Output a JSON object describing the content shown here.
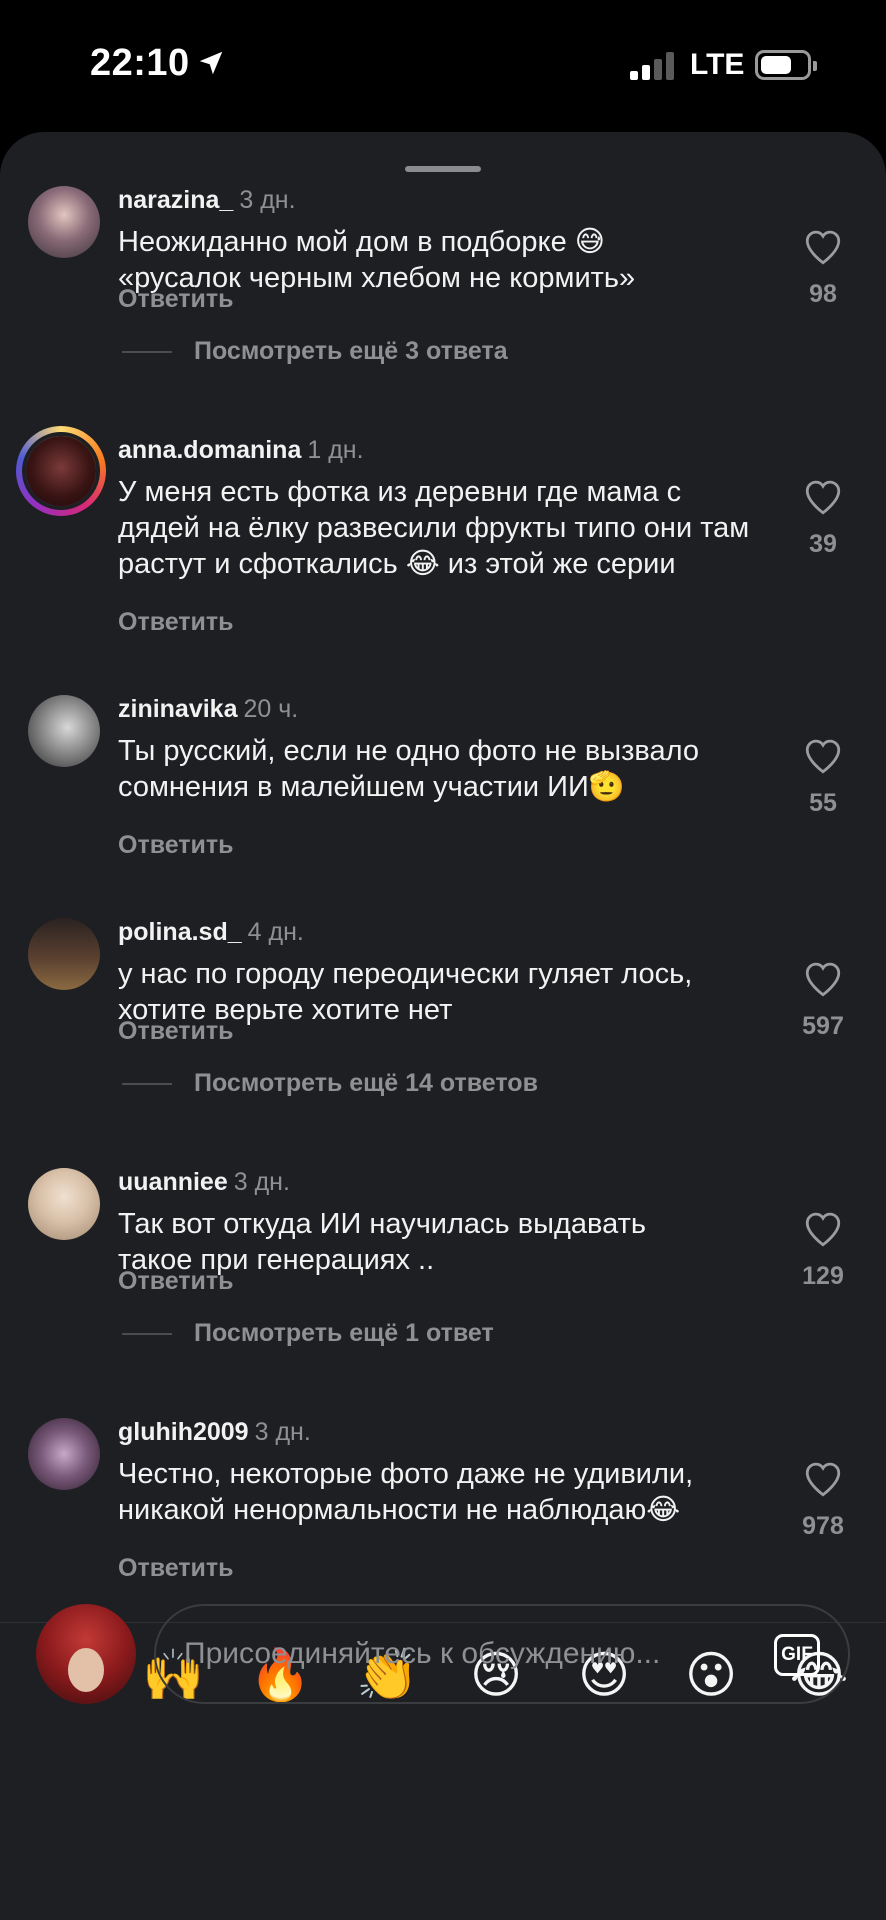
{
  "status_bar": {
    "time": "22:10",
    "network": "LTE",
    "icons": [
      "location-arrow-icon",
      "signal-icon",
      "battery-icon"
    ]
  },
  "comments": [
    {
      "username": "narazina_",
      "time": "3 дн.",
      "text": "Неожиданно мой дом в подборке 😅 «русалок черным хлебом не кормить»",
      "reply_label": "Ответить",
      "likes": "98",
      "view_more": "Посмотреть ещё 3 ответа",
      "avatar_color": "#6b5a66"
    },
    {
      "username": "anna.domanina",
      "time": "1 дн.",
      "text": "У меня есть фотка из деревни где мама с дядей на ёлку развесили фрукты типо они там растут и сфоткались 😂 из этой же серии",
      "reply_label": "Ответить",
      "likes": "39",
      "avatar_color": "#4a2222",
      "has_story_ring": true
    },
    {
      "username": "zininavika",
      "time": "20 ч.",
      "text": "Ты русский, если не одно фото не вызвало сомнения в малейшем участии ИИ🫡",
      "reply_label": "Ответить",
      "likes": "55",
      "avatar_color": "#8a8a8a"
    },
    {
      "username": "polina.sd_",
      "time": "4 дн.",
      "text": "у нас по городу переодически гуляет лось, хотите верьте хотите нет",
      "reply_label": "Ответить",
      "likes": "597",
      "view_more": "Посмотреть ещё 14 ответов",
      "avatar_color": "#5a4030"
    },
    {
      "username": "uuanniee",
      "time": "3 дн.",
      "text": "Так вот откуда ИИ научилась выдавать такое при генерациях ..",
      "reply_label": "Ответить",
      "likes": "129",
      "view_more": "Посмотреть ещё 1 ответ",
      "avatar_color": "#d8c0a8"
    },
    {
      "username": "gluhih2009",
      "time": "3 дн.",
      "text": "Честно, некоторые фото даже не удивили, никакой ненормальности не наблюдаю😂",
      "reply_label": "Ответить",
      "likes": "978",
      "avatar_color": "#7a5a7a"
    }
  ],
  "reactions": [
    "❤️",
    "🙌",
    "🔥",
    "👏",
    "😢",
    "😍",
    "😮",
    "😂"
  ],
  "composer": {
    "placeholder": "Присоединяйтесь к обсуждению...",
    "gif_label": "GIF"
  }
}
